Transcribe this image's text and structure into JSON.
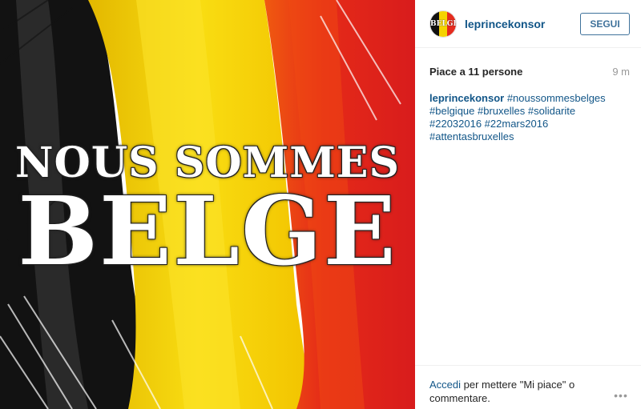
{
  "post": {
    "headline_line1": "NOUS SOMMES",
    "headline_line2": "BELGE",
    "colors": {
      "black": "#111111",
      "yellow": "#f7d40a",
      "red": "#e42a1c"
    }
  },
  "header": {
    "avatar_text": "BELGE",
    "username": "leprincekonsor",
    "follow_label": "SEGUI"
  },
  "meta": {
    "likes": "Piace a 11 persone",
    "time": "9 m"
  },
  "caption": {
    "user": "leprincekonsor",
    "text": " #noussommesbelges #belgique #bruxelles #solidarite #22032016 #22mars2016 #attentasbruxelles"
  },
  "footer": {
    "login_label": "Accedi",
    "message": " per mettere \"Mi piace\" o commentare.",
    "more_icon": "ellipsis-icon"
  }
}
